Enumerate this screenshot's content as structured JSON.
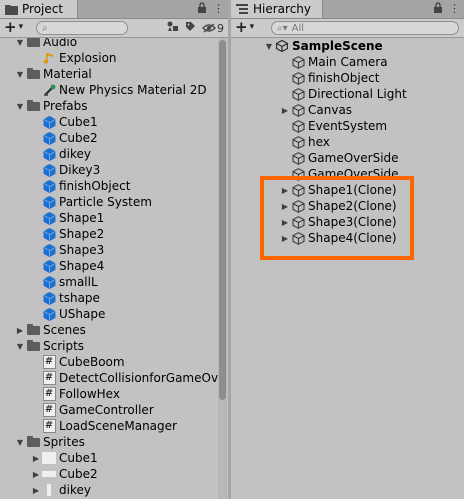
{
  "colors": {
    "panel_bg": "#c2c2c2",
    "highlight": "#ff6600",
    "folder": "#5d5d5d",
    "prefab": "#1d6fd1"
  },
  "project": {
    "tab_title": "Project",
    "tab_icon": "folder-icon",
    "badge": "9",
    "rows": [
      {
        "label": "Audio",
        "kind": "folder",
        "depth": 1,
        "arrow": "down"
      },
      {
        "label": "Explosion",
        "kind": "audio",
        "depth": 2,
        "arrow": ""
      },
      {
        "label": "Material",
        "kind": "folder",
        "depth": 1,
        "arrow": "down"
      },
      {
        "label": "New Physics Material 2D",
        "kind": "physmat",
        "depth": 2,
        "arrow": ""
      },
      {
        "label": "Prefabs",
        "kind": "folder",
        "depth": 1,
        "arrow": "down"
      },
      {
        "label": "Cube1",
        "kind": "prefab",
        "depth": 2,
        "arrow": ""
      },
      {
        "label": "Cube2",
        "kind": "prefab",
        "depth": 2,
        "arrow": ""
      },
      {
        "label": "dikey",
        "kind": "prefab",
        "depth": 2,
        "arrow": ""
      },
      {
        "label": "Dikey3",
        "kind": "prefab",
        "depth": 2,
        "arrow": ""
      },
      {
        "label": "finishObject",
        "kind": "prefab",
        "depth": 2,
        "arrow": ""
      },
      {
        "label": "Particle System",
        "kind": "prefab",
        "depth": 2,
        "arrow": ""
      },
      {
        "label": "Shape1",
        "kind": "prefab",
        "depth": 2,
        "arrow": ""
      },
      {
        "label": "Shape2",
        "kind": "prefab",
        "depth": 2,
        "arrow": ""
      },
      {
        "label": "Shape3",
        "kind": "prefab",
        "depth": 2,
        "arrow": ""
      },
      {
        "label": "Shape4",
        "kind": "prefab",
        "depth": 2,
        "arrow": ""
      },
      {
        "label": "smallL",
        "kind": "prefab",
        "depth": 2,
        "arrow": ""
      },
      {
        "label": "tshape",
        "kind": "prefab",
        "depth": 2,
        "arrow": ""
      },
      {
        "label": "UShape",
        "kind": "prefab",
        "depth": 2,
        "arrow": ""
      },
      {
        "label": "Scenes",
        "kind": "folder",
        "depth": 1,
        "arrow": "right"
      },
      {
        "label": "Scripts",
        "kind": "folder",
        "depth": 1,
        "arrow": "down"
      },
      {
        "label": "CubeBoom",
        "kind": "script",
        "depth": 2,
        "arrow": ""
      },
      {
        "label": "DetectCollisionforGameOve",
        "kind": "script",
        "depth": 2,
        "arrow": ""
      },
      {
        "label": "FollowHex",
        "kind": "script",
        "depth": 2,
        "arrow": ""
      },
      {
        "label": "GameController",
        "kind": "script",
        "depth": 2,
        "arrow": ""
      },
      {
        "label": "LoadSceneManager",
        "kind": "script",
        "depth": 2,
        "arrow": ""
      },
      {
        "label": "Sprites",
        "kind": "folder",
        "depth": 1,
        "arrow": "down"
      },
      {
        "label": "Cube1",
        "kind": "sprite",
        "depth": 2,
        "arrow": "right"
      },
      {
        "label": "Cube2",
        "kind": "sprite-wide",
        "depth": 2,
        "arrow": "right"
      },
      {
        "label": "dikey",
        "kind": "sprite-thin",
        "depth": 2,
        "arrow": "right"
      }
    ]
  },
  "hierarchy": {
    "tab_title": "Hierarchy",
    "search_placeholder": "All",
    "scene": "SampleScene",
    "rows": [
      {
        "label": "Main Camera",
        "arrow": ""
      },
      {
        "label": "finishObject",
        "arrow": ""
      },
      {
        "label": "Directional Light",
        "arrow": ""
      },
      {
        "label": "Canvas",
        "arrow": "right"
      },
      {
        "label": "EventSystem",
        "arrow": ""
      },
      {
        "label": "hex",
        "arrow": ""
      },
      {
        "label": "GameOverSide",
        "arrow": ""
      },
      {
        "label": "GameOverSide",
        "arrow": ""
      },
      {
        "label": "Shape1(Clone)",
        "arrow": "right"
      },
      {
        "label": "Shape2(Clone)",
        "arrow": "right"
      },
      {
        "label": "Shape3(Clone)",
        "arrow": "right"
      },
      {
        "label": "Shape4(Clone)",
        "arrow": "right"
      }
    ]
  }
}
